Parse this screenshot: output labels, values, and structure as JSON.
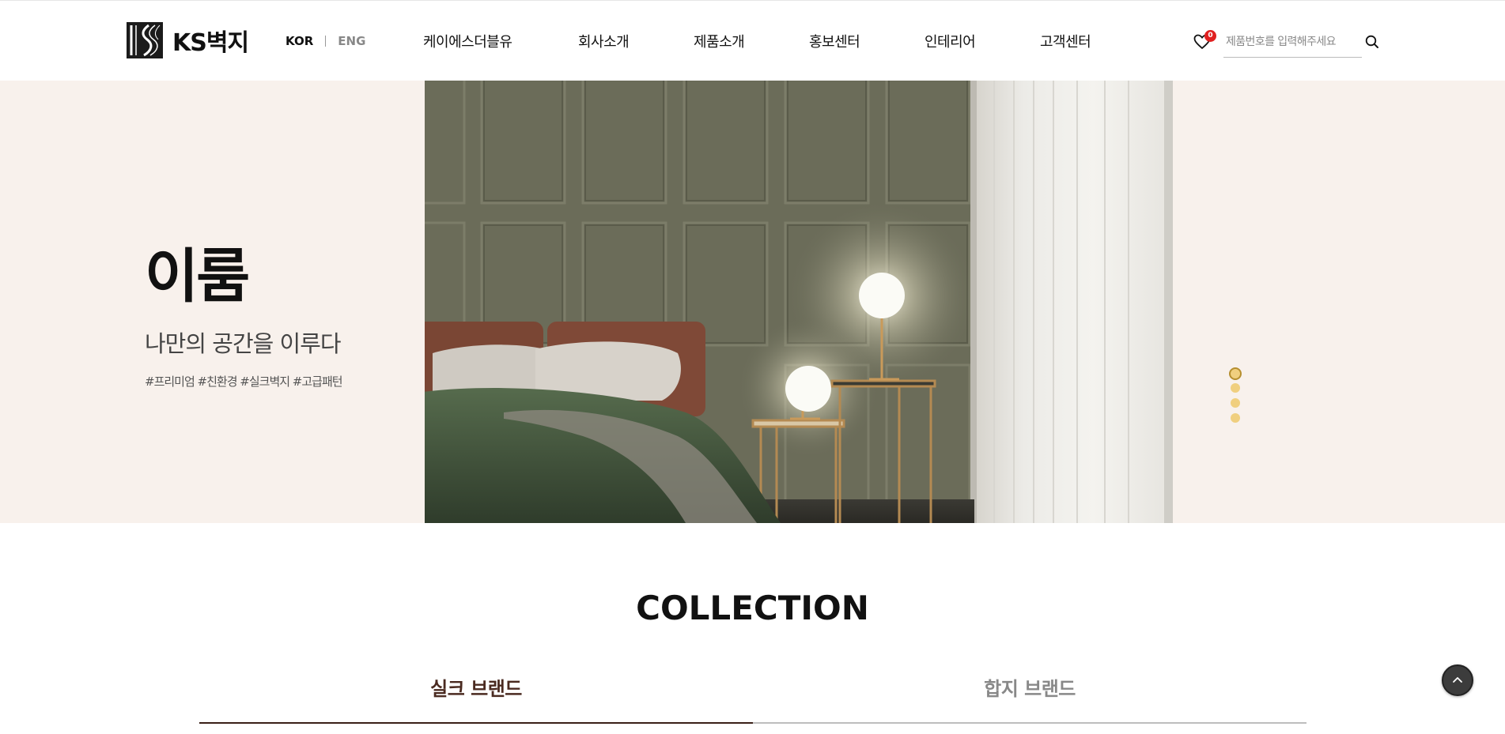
{
  "header": {
    "logo_text": "KS벽지",
    "lang": {
      "kor": "KOR",
      "eng": "ENG"
    },
    "nav": [
      "케이에스더블유",
      "회사소개",
      "제품소개",
      "홍보센터",
      "인테리어",
      "고객센터"
    ],
    "wishlist_count": "0",
    "search_placeholder": "제품번호를 입력해주세요"
  },
  "hero": {
    "title": "이룸",
    "subtitle": "나만의 공간을 이루다",
    "tags": "#프리미엄 #친환경 #실크벽지 #고급패턴",
    "slide_count": 4,
    "active_slide": 1
  },
  "collection": {
    "title": "COLLECTION",
    "tabs": [
      "실크 브랜드",
      "합지 브랜드"
    ],
    "active_tab": 0
  },
  "colors": {
    "hero_bg": "#f8f1ec",
    "dot": "#f0cf7f",
    "tab_active": "#3a1f17",
    "badge": "#e02020"
  },
  "icons": [
    "logo-mark",
    "heart-icon",
    "search-icon",
    "arrow-up-icon"
  ]
}
